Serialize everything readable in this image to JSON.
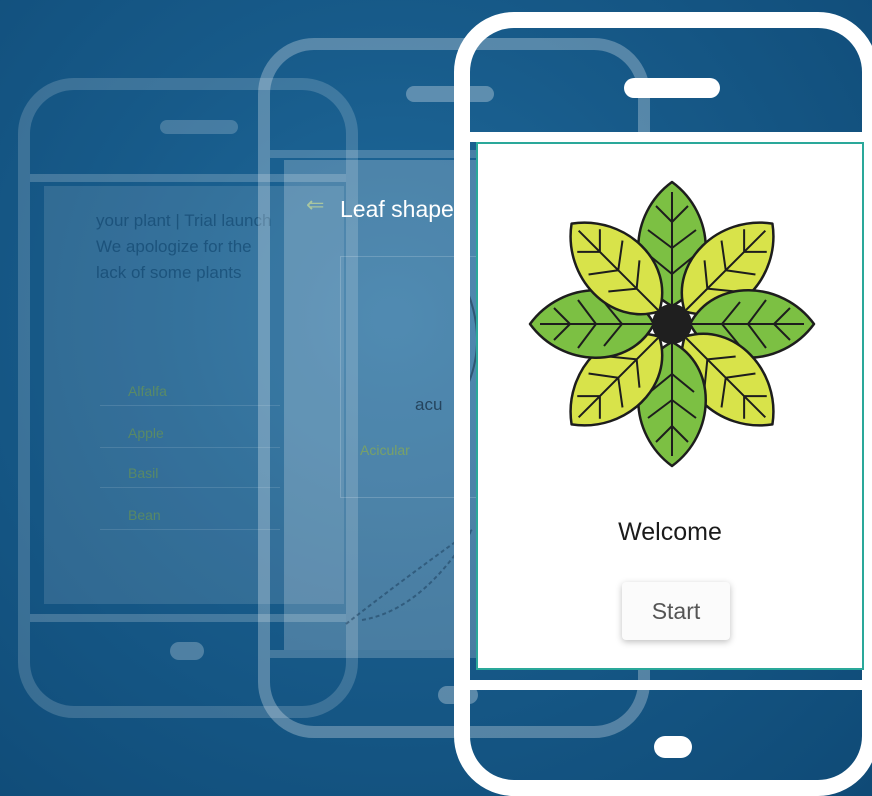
{
  "back_phone": {
    "paragraph": "your plant | Trial launch We apologize for the lack of some plants",
    "options": [
      "Alfalfa",
      "Apple",
      "Basil",
      "Bean"
    ]
  },
  "mid_phone": {
    "heading": "Leaf shape",
    "partial_label": "acu",
    "option": "Acicular"
  },
  "front_phone": {
    "welcome": "Welcome",
    "start_label": "Start"
  },
  "colors": {
    "background": "#175a89",
    "screen_border": "#2aa89a",
    "leaf_yellow": "#d8e34a",
    "leaf_green": "#7cc043"
  },
  "icons": [
    "leaf-flower-logo-icon",
    "back-arrow-icon"
  ]
}
